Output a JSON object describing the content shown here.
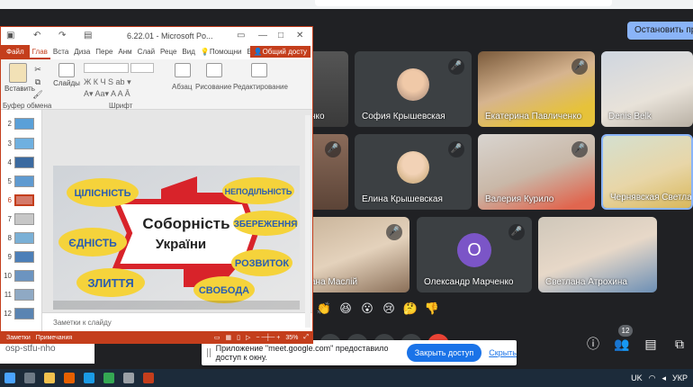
{
  "browser": {
    "stop_presenting": "Остановить презе"
  },
  "powerpoint": {
    "title": "6.22.01 - Microsoft Po...",
    "search_label": "Помощни",
    "signin_label": "Вход",
    "share_label": "Общий досту",
    "tabs": [
      "Файл",
      "Глав",
      "Вста",
      "Диза",
      "Пере",
      "Анм",
      "Слай",
      "Реце",
      "Вид"
    ],
    "ribbon": {
      "paste": "Вставить",
      "clipboard": "Буфер обмена",
      "slides": "Слайды",
      "font": "Шрифт",
      "paragraph": "Абзац",
      "drawing": "Рисование",
      "editing": "Редактирование"
    },
    "thumb_numbers": [
      "2",
      "3",
      "4",
      "5",
      "6",
      "7",
      "8",
      "9",
      "10",
      "11",
      "12"
    ],
    "selected_slide": "6",
    "slide_title_line1": "Соборність",
    "slide_title_line2": "України",
    "slide_words": [
      "ЦІЛІСНІСТЬ",
      "ЄДНІСТЬ",
      "ЗЛИТТЯ",
      "НЕПОДІЛЬНІСТЬ",
      "ЗБЕРЕЖЕННЯ",
      "РОЗВИТОК",
      "СВОБОДА"
    ],
    "notes_placeholder": "Заметки к слайду",
    "status_notes": "Заметки",
    "status_comments": "Примечания",
    "zoom": "35%"
  },
  "meet": {
    "participants": [
      {
        "name": "нко",
        "muted": false
      },
      {
        "name": "София Крышевская",
        "muted": true
      },
      {
        "name": "Екатерина Павличенко",
        "muted": true
      },
      {
        "name": "Denis Belk",
        "muted": false
      },
      {
        "name": "",
        "muted": true
      },
      {
        "name": "Елина Крышевская",
        "muted": true
      },
      {
        "name": "Валерия Курило",
        "muted": true
      },
      {
        "name": "Чернявская Светлана",
        "muted": false
      },
      {
        "name": "ана Маслій",
        "muted": true
      },
      {
        "name": "Олександр Марченко",
        "muted": true,
        "initial": "O"
      },
      {
        "name": "Светлана Атрохина",
        "muted": false
      }
    ],
    "reactions": [
      "👏",
      "😆",
      "😮",
      "😢",
      "🤔",
      "👎"
    ],
    "people_count": "12",
    "bottom_left_text": "osp-stfu-nho"
  },
  "share_banner": {
    "message": "Приложение \"meet.google.com\" предоставило доступ к окну.",
    "close_access": "Закрыть доступ",
    "hide": "Скрыть"
  },
  "taskbar": {
    "lang": "UK",
    "lang2": "УКР"
  },
  "colors": {
    "ppt_accent": "#c43e1c",
    "meet_bg": "#202124",
    "meet_blue": "#8ab4f8",
    "button_blue": "#1a73e8"
  }
}
